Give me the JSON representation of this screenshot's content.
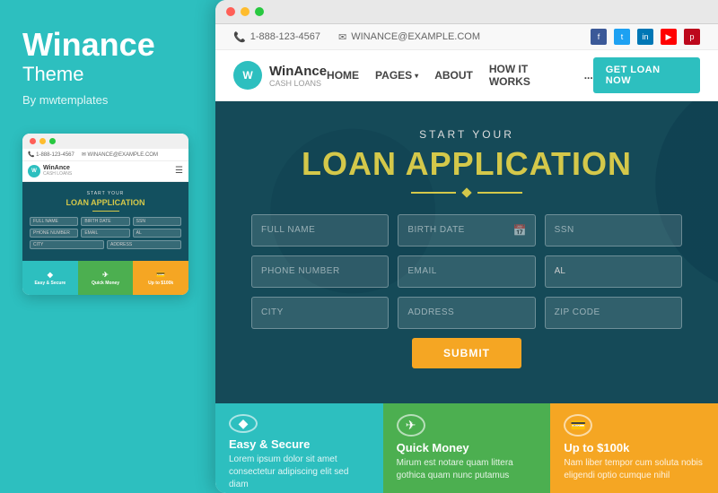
{
  "left": {
    "brand_name": "Winance",
    "brand_sub": "Theme",
    "by_line": "By mwtemplates"
  },
  "browser": {
    "dots": [
      "red",
      "yellow",
      "green"
    ]
  },
  "topbar": {
    "phone": "1-888-123-4567",
    "email": "WINANCE@EXAMPLE.COM",
    "socials": [
      "f",
      "t",
      "in",
      "▶",
      "p"
    ]
  },
  "nav": {
    "logo_letter": "W",
    "logo_main": "WinAnce",
    "logo_sub": "CASH LOANS",
    "links": [
      "HOME",
      "PAGES",
      "ABOUT",
      "HOW IT WORKS",
      "..."
    ],
    "cta": "GET LOAN NOW"
  },
  "hero": {
    "start_your": "START YOUR",
    "title": "LOAN APPLICATION"
  },
  "form": {
    "full_name": "FULL NAME",
    "birth_date": "BIRTH DATE",
    "ssn": "SSN",
    "phone": "PHONE NUMBER",
    "email": "EMAIL",
    "state": "AL",
    "city": "CITY",
    "address": "ADDRESS",
    "zip": "ZIP CODE",
    "submit": "SUBMIT"
  },
  "features": [
    {
      "icon": "◆",
      "title": "Easy & Secure",
      "text": "Lorem ipsum dolor sit amet consectetur adipiscing elit sed diam",
      "color": "teal"
    },
    {
      "icon": "✈",
      "title": "Quick Money",
      "text": "Mirum est notare quam littera gothica quam nunc putamus",
      "color": "green"
    },
    {
      "icon": "💳",
      "title": "Up to $100k",
      "text": "Nam liber tempor cum soluta nobis eligendi optio cumque nihil",
      "color": "orange"
    }
  ],
  "mini": {
    "hero_title": "LOAN APPLICATION",
    "hero_sub": "START YOUR",
    "cards": [
      "Easy & Secure",
      "Quick Money",
      "Up to $100k"
    ]
  }
}
